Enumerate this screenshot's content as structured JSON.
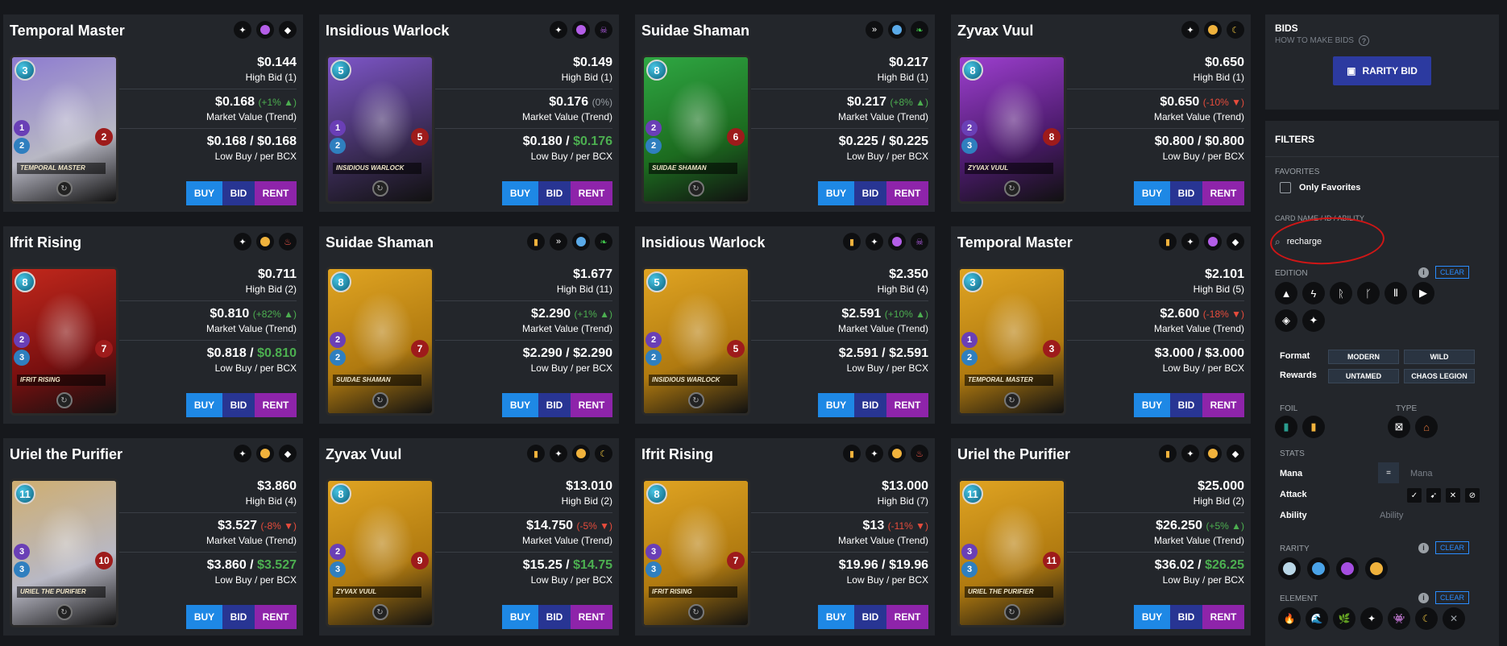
{
  "cards": [
    {
      "name": "Temporal Master",
      "chips": [
        "neutral",
        "purple",
        "diamond"
      ],
      "bg": "#b8b8c4",
      "art": "#8d7bd0",
      "mana": "3",
      "banner": "Temporal Master",
      "health": "2",
      "s1": "1",
      "s2": "2",
      "top_price": "$0.144",
      "top_sub": "High Bid (1)",
      "mv": "$0.168",
      "mv_pct": "(+1% ▲)",
      "mv_dir": "up",
      "mv_sub": "Market Value (Trend)",
      "low_a": "$0.168 / ",
      "low_b": "$0.168",
      "low_b_green": false,
      "low_sub": "Low Buy / per BCX"
    },
    {
      "name": "Insidious Warlock",
      "chips": [
        "neutral",
        "purple",
        "skull"
      ],
      "bg": "#3a2b55",
      "art": "#7e56c9",
      "mana": "5",
      "banner": "Insidious Warlock",
      "health": "5",
      "s1": "1",
      "s2": "2",
      "top_price": "$0.149",
      "top_sub": "High Bid (1)",
      "mv": "$0.176",
      "mv_pct": "(0%)",
      "mv_dir": "flat",
      "mv_sub": "Market Value (Trend)",
      "low_a": "$0.180 / ",
      "low_b": "$0.176",
      "low_b_green": true,
      "low_sub": "Low Buy / per BCX"
    },
    {
      "name": "Suidae Shaman",
      "chips": [
        "wings",
        "blue",
        "leaf"
      ],
      "bg": "#1c6b1f",
      "art": "#2fa843",
      "mana": "8",
      "banner": "Suidae Shaman",
      "health": "6",
      "s1": "2",
      "s2": "2",
      "top_price": "$0.217",
      "top_sub": "High Bid (1)",
      "mv": "$0.217",
      "mv_pct": "(+8% ▲)",
      "mv_dir": "up",
      "mv_sub": "Market Value (Trend)",
      "low_a": "$0.225 / ",
      "low_b": "$0.225",
      "low_b_green": false,
      "low_sub": "Low Buy / per BCX"
    },
    {
      "name": "Zyvax Vuul",
      "chips": [
        "neutral",
        "gold",
        "moon"
      ],
      "bg": "#4a1a6a",
      "art": "#9d3fcf",
      "mana": "8",
      "banner": "Zyvax Vuul",
      "health": "8",
      "s1": "2",
      "s2": "3",
      "top_price": "$0.650",
      "top_sub": "High Bid (1)",
      "mv": "$0.650",
      "mv_pct": "(-10% ▼)",
      "mv_dir": "down",
      "mv_sub": "Market Value (Trend)",
      "low_a": "$0.800 / ",
      "low_b": "$0.800",
      "low_b_green": false,
      "low_sub": "Low Buy / per BCX"
    },
    {
      "name": "Ifrit Rising",
      "chips": [
        "neutral",
        "gold",
        "fire"
      ],
      "bg": "#7a1010",
      "art": "#c2281c",
      "mana": "8",
      "banner": "Ifrit Rising",
      "health": "7",
      "s1": "2",
      "s2": "3",
      "top_price": "$0.711",
      "top_sub": "High Bid (2)",
      "mv": "$0.810",
      "mv_pct": "(+82% ▲)",
      "mv_dir": "up",
      "mv_sub": "Market Value (Trend)",
      "low_a": "$0.818 / ",
      "low_b": "$0.810",
      "low_b_green": true,
      "low_sub": "Low Buy / per BCX"
    },
    {
      "name": "Suidae Shaman",
      "chips": [
        "gold-foil",
        "wings",
        "blue",
        "leaf"
      ],
      "bg": "#b07a10",
      "art": "#e0a422",
      "mana": "8",
      "banner": "Suidae Shaman",
      "health": "7",
      "s1": "2",
      "s2": "2",
      "top_price": "$1.677",
      "top_sub": "High Bid (11)",
      "mv": "$2.290",
      "mv_pct": "(+1% ▲)",
      "mv_dir": "up",
      "mv_sub": "Market Value (Trend)",
      "low_a": "$2.290 / ",
      "low_b": "$2.290",
      "low_b_green": false,
      "low_sub": "Low Buy / per BCX"
    },
    {
      "name": "Insidious Warlock",
      "chips": [
        "gold-foil",
        "neutral",
        "purple",
        "skull"
      ],
      "bg": "#b07a10",
      "art": "#e0a422",
      "mana": "5",
      "banner": "Insidious Warlock",
      "health": "5",
      "s1": "2",
      "s2": "2",
      "top_price": "$2.350",
      "top_sub": "High Bid (4)",
      "mv": "$2.591",
      "mv_pct": "(+10% ▲)",
      "mv_dir": "up",
      "mv_sub": "Market Value (Trend)",
      "low_a": "$2.591 / ",
      "low_b": "$2.591",
      "low_b_green": false,
      "low_sub": "Low Buy / per BCX"
    },
    {
      "name": "Temporal Master",
      "chips": [
        "gold-foil",
        "neutral",
        "purple",
        "diamond"
      ],
      "bg": "#b07a10",
      "art": "#e0a422",
      "mana": "3",
      "banner": "Temporal Master",
      "health": "3",
      "s1": "1",
      "s2": "2",
      "top_price": "$2.101",
      "top_sub": "High Bid (5)",
      "mv": "$2.600",
      "mv_pct": "(-18% ▼)",
      "mv_dir": "down",
      "mv_sub": "Market Value (Trend)",
      "low_a": "$3.000 / ",
      "low_b": "$3.000",
      "low_b_green": false,
      "low_sub": "Low Buy / per BCX"
    },
    {
      "name": "Uriel the Purifier",
      "chips": [
        "neutral",
        "gold",
        "diamond"
      ],
      "bg": "#b8b8c4",
      "art": "#cfae70",
      "mana": "11",
      "banner": "Uriel the Purifier",
      "health": "10",
      "s1": "3",
      "s2": "3",
      "top_price": "$3.860",
      "top_sub": "High Bid (4)",
      "mv": "$3.527",
      "mv_pct": "(-8% ▼)",
      "mv_dir": "down",
      "mv_sub": "Market Value (Trend)",
      "low_a": "$3.860 / ",
      "low_b": "$3.527",
      "low_b_green": true,
      "low_sub": "Low Buy / per BCX"
    },
    {
      "name": "Zyvax Vuul",
      "chips": [
        "gold-foil",
        "neutral",
        "gold",
        "moon"
      ],
      "bg": "#b07a10",
      "art": "#e0a422",
      "mana": "8",
      "banner": "Zyvax Vuul",
      "health": "9",
      "s1": "2",
      "s2": "3",
      "top_price": "$13.010",
      "top_sub": "High Bid (2)",
      "mv": "$14.750",
      "mv_pct": "(-5% ▼)",
      "mv_dir": "down",
      "mv_sub": "Market Value (Trend)",
      "low_a": "$15.25 / ",
      "low_b": "$14.75",
      "low_b_green": true,
      "low_sub": "Low Buy / per BCX"
    },
    {
      "name": "Ifrit Rising",
      "chips": [
        "gold-foil",
        "neutral",
        "gold",
        "fire"
      ],
      "bg": "#b07a10",
      "art": "#e0a422",
      "mana": "8",
      "banner": "Ifrit Rising",
      "health": "7",
      "s1": "3",
      "s2": "3",
      "top_price": "$13.000",
      "top_sub": "High Bid (7)",
      "mv": "$13",
      "mv_pct": "(-11% ▼)",
      "mv_dir": "down",
      "mv_sub": "Market Value (Trend)",
      "low_a": "$19.96 / ",
      "low_b": "$19.96",
      "low_b_green": false,
      "low_sub": "Low Buy / per BCX"
    },
    {
      "name": "Uriel the Purifier",
      "chips": [
        "gold-foil",
        "neutral",
        "gold",
        "diamond"
      ],
      "bg": "#b07a10",
      "art": "#e0a422",
      "mana": "11",
      "banner": "Uriel the Purifier",
      "health": "11",
      "s1": "3",
      "s2": "3",
      "top_price": "$25.000",
      "top_sub": "High Bid (2)",
      "mv": "$26.250",
      "mv_pct": "(+5% ▲)",
      "mv_dir": "up",
      "mv_sub": "Market Value (Trend)",
      "low_a": "$36.02 / ",
      "low_b": "$26.25",
      "low_b_green": true,
      "low_sub": "Low Buy / per BCX"
    }
  ],
  "buttons": {
    "buy": "BUY",
    "bid": "BID",
    "rent": "RENT"
  },
  "colors": {
    "buy": "#1e88e5",
    "bid": "#283593",
    "rent": "#8e24aa",
    "up": "#4caf50",
    "down": "#e74c3c",
    "accent": "#2a8cff",
    "annotation": "#d01616"
  },
  "sidebar": {
    "bids_title": "BIDS",
    "how_to": "HOW TO MAKE BIDS",
    "rarity_bid": "RARITY BID",
    "filters_title": "FILTERS",
    "favorites_label": "FAVORITES",
    "only_favorites": "Only Favorites",
    "card_name_label": "CARD NAME / ID / ABILITY",
    "search_value": "recharge",
    "edition_label": "EDITION",
    "clear": "CLEAR",
    "edition_icons": [
      "▲",
      "ϟ",
      "ᚱ",
      "ᚴ",
      "Ⅱ",
      "▶",
      "◈",
      "✦"
    ],
    "format_label": "Format",
    "format_options": [
      "MODERN",
      "WILD"
    ],
    "rewards_label": "Rewards",
    "rewards_options": [
      "UNTAMED",
      "CHAOS LEGION"
    ],
    "foil_label": "FOIL",
    "type_label": "TYPE",
    "stats_label": "STATS",
    "mana_label": "Mana",
    "mana_op": "=",
    "mana_placeholder": "Mana",
    "attack_label": "Attack",
    "ability_label": "Ability",
    "ability_placeholder": "Ability",
    "rarity_label": "RARITY",
    "rarity_colors": [
      "#b9d6e6",
      "#4aa3e8",
      "#a54ee0",
      "#f0b23c"
    ],
    "element_label": "ELEMENT",
    "element_icons": [
      "🔥",
      "🌊",
      "🌿",
      "✦",
      "👾",
      "☾",
      "✕"
    ]
  }
}
